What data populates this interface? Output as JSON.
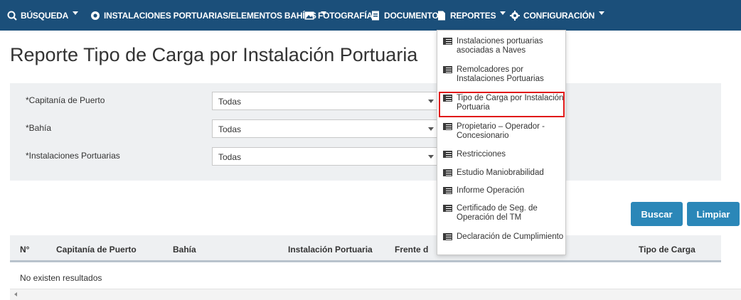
{
  "nav": {
    "busqueda": "BÚSQUEDA",
    "instalaciones": "INSTALACIONES PORTUARIAS/ELEMENTOS BAHÍAS",
    "fotografia": "FOTOGRAFÍA",
    "documento": "DOCUMENTO",
    "reportes": "REPORTES",
    "configuracion": "CONFIGURACIÓN"
  },
  "page": {
    "title": "Reporte Tipo de Carga por Instalación Portuaria"
  },
  "filters": {
    "capitania": {
      "label": "*Capitanía de Puerto",
      "value": "Todas"
    },
    "bahia": {
      "label": "*Bahía",
      "value": "Todas"
    },
    "instalaciones": {
      "label": "*Instalaciones Portuarias",
      "value": "Todas"
    }
  },
  "buttons": {
    "buscar": "Buscar",
    "limpiar": "Limpiar"
  },
  "table": {
    "columns": [
      "N°",
      "Capitanía de Puerto",
      "Bahía",
      "Instalación Portuaria",
      "Frente d",
      "Tipo de Carga"
    ],
    "empty": "No existen resultados"
  },
  "menu": {
    "items": [
      "Instalaciones portuarias asociadas a Naves",
      "Remolcadores por Instalaciones Portuarias",
      "Tipo de Carga por Instalación Portuaria",
      "Propietario – Operador - Concesionario",
      "Restricciones",
      "Estudio Maniobrabilidad",
      "Informe Operación",
      "Certificado de Seg. de Operación del TM",
      "Declaración de Cumplimiento"
    ]
  },
  "colors": {
    "nav": "#1b4f7a",
    "button": "#2b87b8",
    "highlight": "#e01818"
  }
}
